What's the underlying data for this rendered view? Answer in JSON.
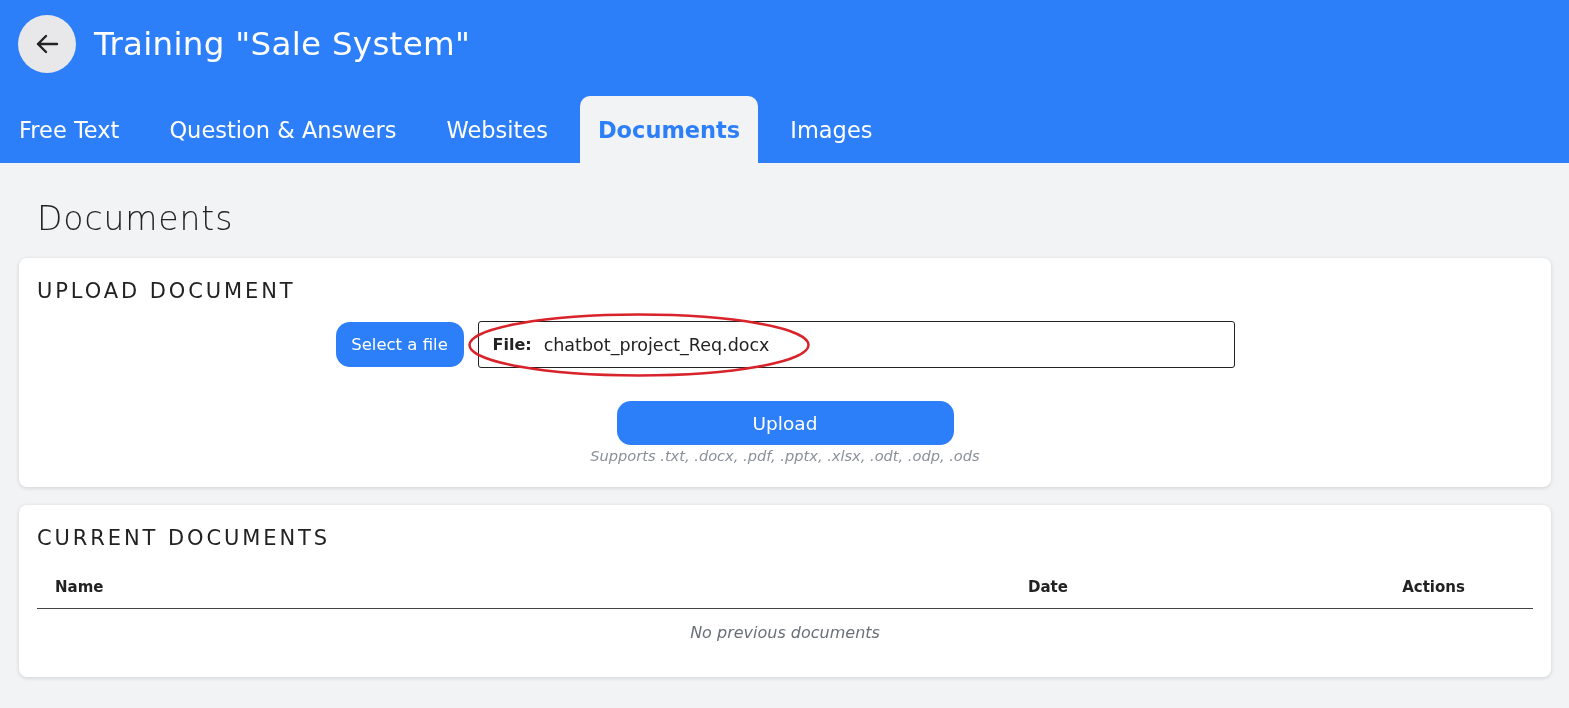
{
  "header": {
    "title": "Training \"Sale System\""
  },
  "tabs": [
    {
      "label": "Free Text",
      "selected": false
    },
    {
      "label": "Question & Answers",
      "selected": false
    },
    {
      "label": "Websites",
      "selected": false
    },
    {
      "label": "Documents",
      "selected": true
    },
    {
      "label": "Images",
      "selected": false
    }
  ],
  "page_title": "Documents",
  "upload": {
    "heading": "UPLOAD DOCUMENT",
    "select_button": "Select a file",
    "file_field": {
      "label": "File:",
      "value": "chatbot_project_Req.docx"
    },
    "annotation": {
      "kind": "ellipse"
    },
    "upload_button": "Upload",
    "hint": "Supports .txt, .docx, .pdf, .pptx, .xlsx, .odt, .odp, .ods"
  },
  "documents": {
    "heading": "CURRENT DOCUMENTS",
    "table": {
      "columns": [
        "Name",
        "Date",
        "Actions"
      ],
      "empty_message": "No previous documents"
    }
  }
}
